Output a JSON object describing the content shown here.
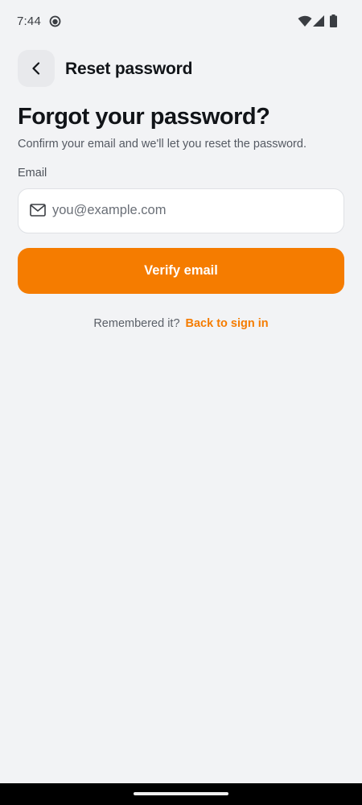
{
  "status_bar": {
    "time": "7:44",
    "icons": [
      "notification-icon",
      "wifi-icon",
      "cell-signal-icon",
      "battery-icon"
    ]
  },
  "header": {
    "back_icon": "chevron-left-icon",
    "title": "Reset password"
  },
  "main": {
    "title": "Forgot your password?",
    "subtitle": "Confirm your email and we'll let you reset the password.",
    "email": {
      "label": "Email",
      "icon": "mail-icon",
      "value": "",
      "placeholder": "you@example.com"
    },
    "verify_button": "Verify email",
    "footer": {
      "prompt": "Remembered it?",
      "link": "Back to sign in"
    }
  },
  "colors": {
    "background": "#f2f3f5",
    "accent": "#f57c00",
    "text_primary": "#111418",
    "text_secondary": "#555a63",
    "field_background": "#ffffff",
    "back_button_background": "#e8e9ec"
  }
}
